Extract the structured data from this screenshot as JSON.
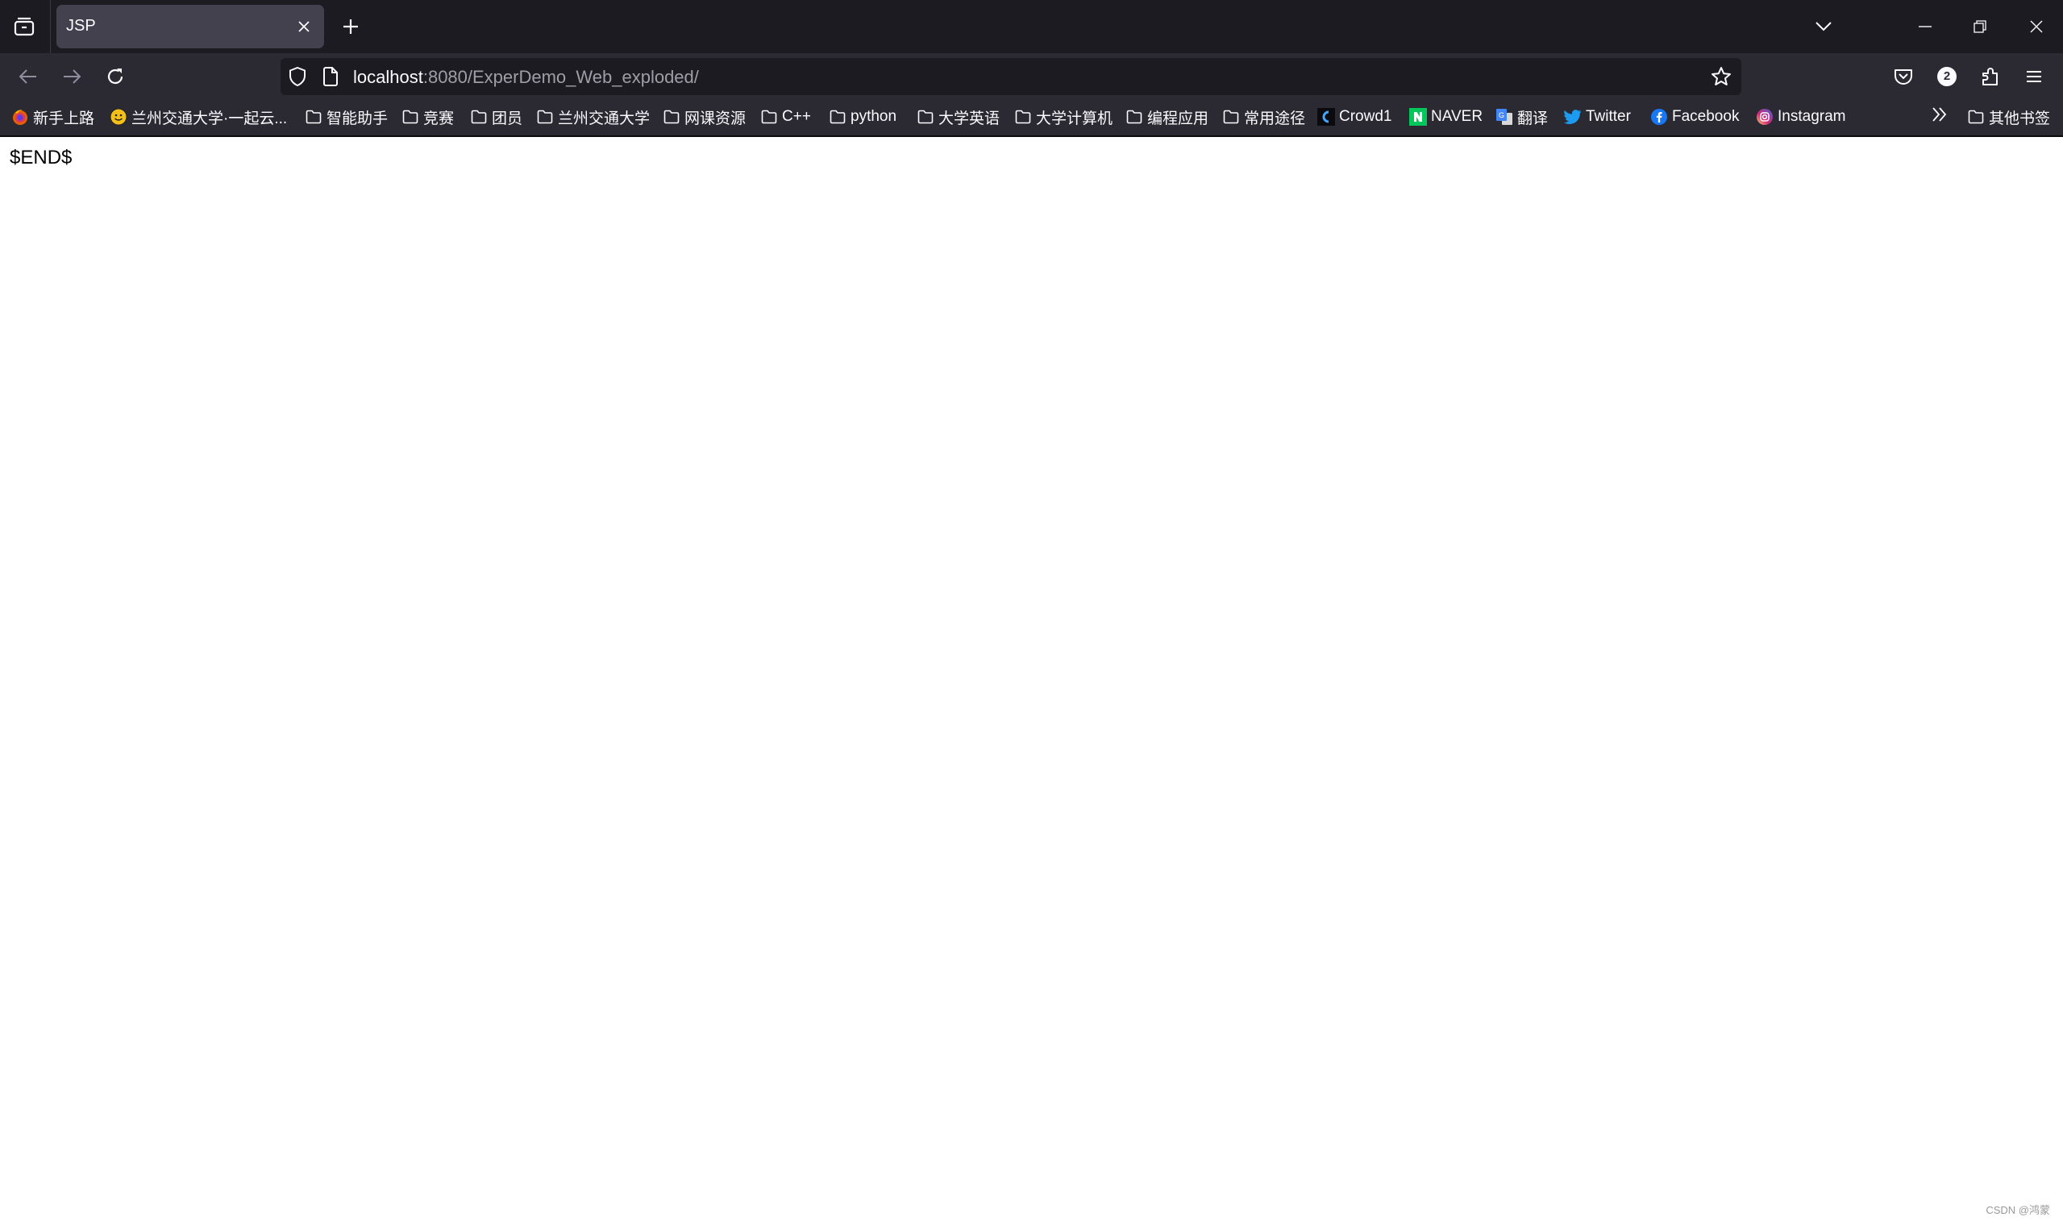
{
  "browser": {
    "tab": {
      "title": "JSP"
    },
    "address_bar": {
      "host": "localhost",
      "path": ":8080/ExperDemo_Web_exploded/"
    },
    "toolbar_badge": "2",
    "bookmarks": [
      {
        "label": "新手上路",
        "icon": "firefox-icon"
      },
      {
        "label": "兰州交通大学·一起云...",
        "icon": "smiley-icon"
      },
      {
        "label": "智能助手",
        "icon": "folder-icon"
      },
      {
        "label": "竞赛",
        "icon": "folder-icon"
      },
      {
        "label": "团员",
        "icon": "folder-icon"
      },
      {
        "label": "兰州交通大学",
        "icon": "folder-icon"
      },
      {
        "label": "网课资源",
        "icon": "folder-icon"
      },
      {
        "label": "C++",
        "icon": "folder-icon"
      },
      {
        "label": "python",
        "icon": "folder-icon"
      },
      {
        "label": "大学英语",
        "icon": "folder-icon"
      },
      {
        "label": "大学计算机",
        "icon": "folder-icon"
      },
      {
        "label": "编程应用",
        "icon": "folder-icon"
      },
      {
        "label": "常用途径",
        "icon": "folder-icon"
      },
      {
        "label": "Crowd1",
        "icon": "crowd1-icon"
      },
      {
        "label": "NAVER",
        "icon": "naver-icon"
      },
      {
        "label": "翻译",
        "icon": "translate-icon"
      },
      {
        "label": "Twitter",
        "icon": "twitter-icon"
      },
      {
        "label": "Facebook",
        "icon": "facebook-icon"
      },
      {
        "label": "Instagram",
        "icon": "instagram-icon"
      }
    ],
    "other_bookmarks": {
      "label": "其他书签",
      "icon": "folder-icon"
    }
  },
  "page": {
    "body_text": "$END$"
  },
  "watermark": "CSDN @鸿蒙"
}
